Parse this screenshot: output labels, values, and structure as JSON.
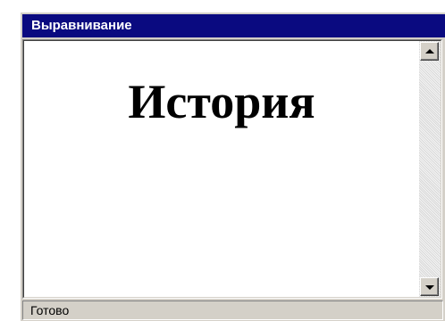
{
  "window": {
    "title": "Выравнивание"
  },
  "document": {
    "heading": "История"
  },
  "status": {
    "text": "Готово"
  },
  "colors": {
    "titlebar": "#0a0a80",
    "titlebar_text": "#ffffff",
    "chrome": "#d4d0c8",
    "document_background": "#ffffff"
  },
  "icons": {
    "scroll_up": "arrow-up-icon",
    "scroll_down": "arrow-down-icon"
  }
}
